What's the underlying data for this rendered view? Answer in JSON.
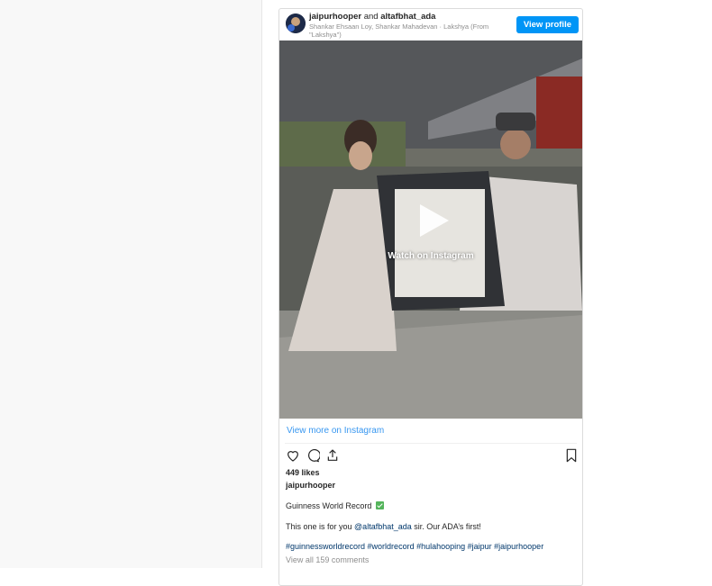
{
  "post": {
    "header": {
      "user1": "jaipurhooper",
      "and": "and",
      "user2": "altafbhat_ada",
      "audio": "Shankar Ehsaan Loy, Shankar Mahadevan · Lakshya (From \"Lakshya\")",
      "view_profile": "View profile"
    },
    "media": {
      "watch_label": "Watch on Instagram",
      "play_icon": "play-icon"
    },
    "view_more": "View more on Instagram",
    "actions": {
      "like_icon": "heart-icon",
      "comment_icon": "comment-icon",
      "share_icon": "share-icon",
      "save_icon": "bookmark-icon"
    },
    "likes": "449 likes",
    "caption_user": "jaipurhooper",
    "caption_line1": "Guinness World Record",
    "caption_line2_prefix": "This one is for you ",
    "caption_mention": "@altafbhat_ada",
    "caption_line2_suffix": " sir. Our ADA’s first!",
    "hashtags": "#guinnessworldrecord #worldrecord #hulahooping #jaipur #jaipurhooper",
    "comments": "View all 159 comments",
    "colors": {
      "accent": "#0095f6",
      "link": "#3897f0",
      "check": "#54b45b"
    }
  }
}
